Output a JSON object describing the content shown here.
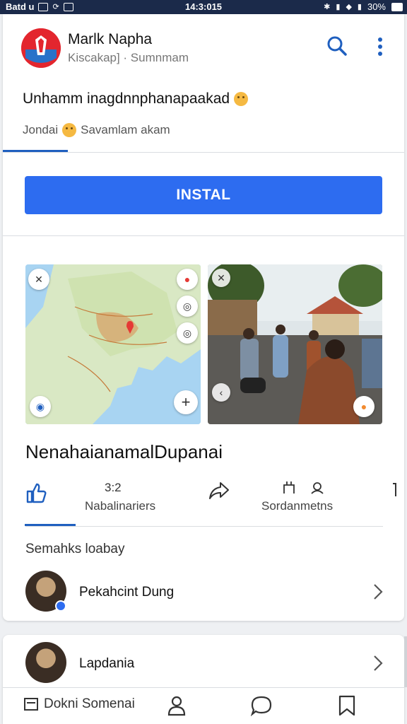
{
  "status_bar": {
    "carrier": "Batd u",
    "time": "14:3:015",
    "battery": "30%"
  },
  "post": {
    "author_name": "Marlk Napha",
    "author_sub": "Kiscakap] · Sumnmam",
    "text": "Unhamm inagdnnphanapaakad",
    "reaction_text": "Jondai",
    "reaction_sub": "Savamlam akam",
    "install_label": "INSTAL",
    "headline": "NenahaianamalDupanai",
    "like_count": "3:2",
    "action_label_1": "Nabalinariers",
    "action_label_2": "Sordanmetns"
  },
  "comments": {
    "title": "Semahks loabay",
    "items": [
      {
        "name": "Pekahcint Dung"
      },
      {
        "name": "Lapdania"
      }
    ]
  },
  "bottom_nav": {
    "label": "Dokni Somenai"
  },
  "colors": {
    "accent": "#2d6cf0",
    "status_bar": "#1b2a4a",
    "tab_indicator": "#1f5fbf"
  },
  "icons": [
    "search-icon",
    "more-vert-icon",
    "like-icon",
    "share-icon",
    "users-icon",
    "chevron-right-icon",
    "profile-icon",
    "chat-icon",
    "bookmark-icon"
  ]
}
